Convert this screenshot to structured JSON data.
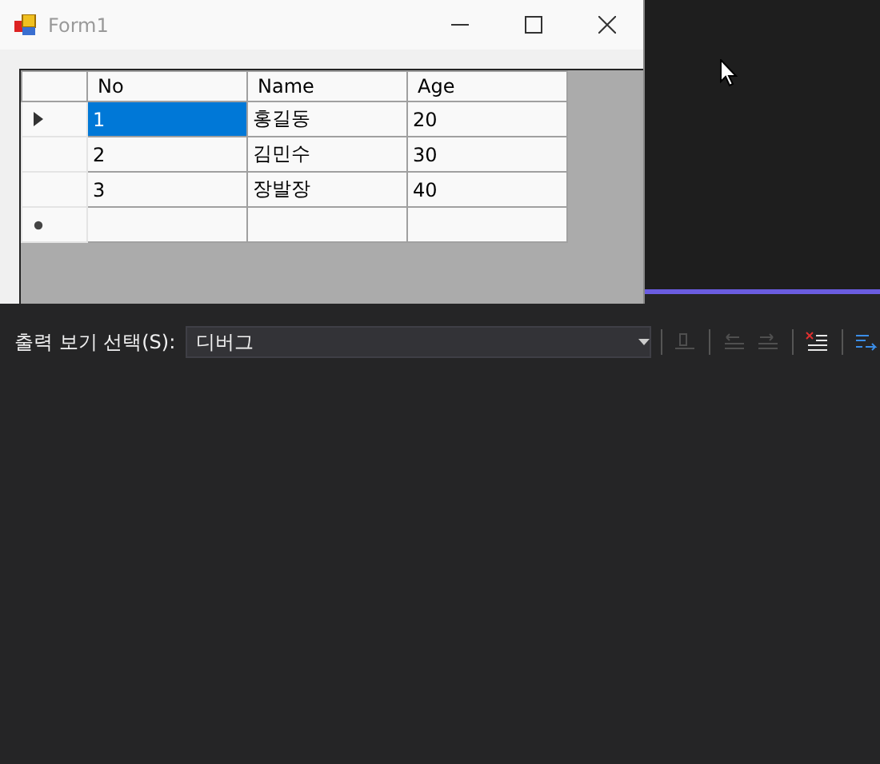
{
  "form": {
    "title": "Form1",
    "grid": {
      "columns": [
        "No",
        "Name",
        "Age"
      ],
      "rows": [
        {
          "kind": "data",
          "current": true,
          "cells": [
            {
              "text": "1",
              "selected": true
            },
            {
              "text": "홍길동",
              "selected": false
            },
            {
              "text": "20",
              "selected": false
            }
          ]
        },
        {
          "kind": "data",
          "current": false,
          "cells": [
            {
              "text": "2",
              "selected": false
            },
            {
              "text": "김민수",
              "selected": false
            },
            {
              "text": "30",
              "selected": false
            }
          ]
        },
        {
          "kind": "data",
          "current": false,
          "cells": [
            {
              "text": "3",
              "selected": false
            },
            {
              "text": "장발장",
              "selected": false
            },
            {
              "text": "40",
              "selected": false
            }
          ]
        },
        {
          "kind": "new",
          "current": false,
          "cells": [
            {
              "text": "",
              "selected": false
            },
            {
              "text": "",
              "selected": false
            },
            {
              "text": "",
              "selected": false
            }
          ]
        }
      ]
    }
  },
  "output": {
    "label": "출력 보기 선택(S):",
    "source": "디버그",
    "tools": [
      {
        "kind": "goto",
        "disabled": true
      },
      {
        "kind": "prev",
        "disabled": true
      },
      {
        "kind": "next",
        "disabled": true
      },
      {
        "kind": "clear",
        "disabled": false
      },
      {
        "kind": "wrap",
        "disabled": false
      }
    ]
  }
}
